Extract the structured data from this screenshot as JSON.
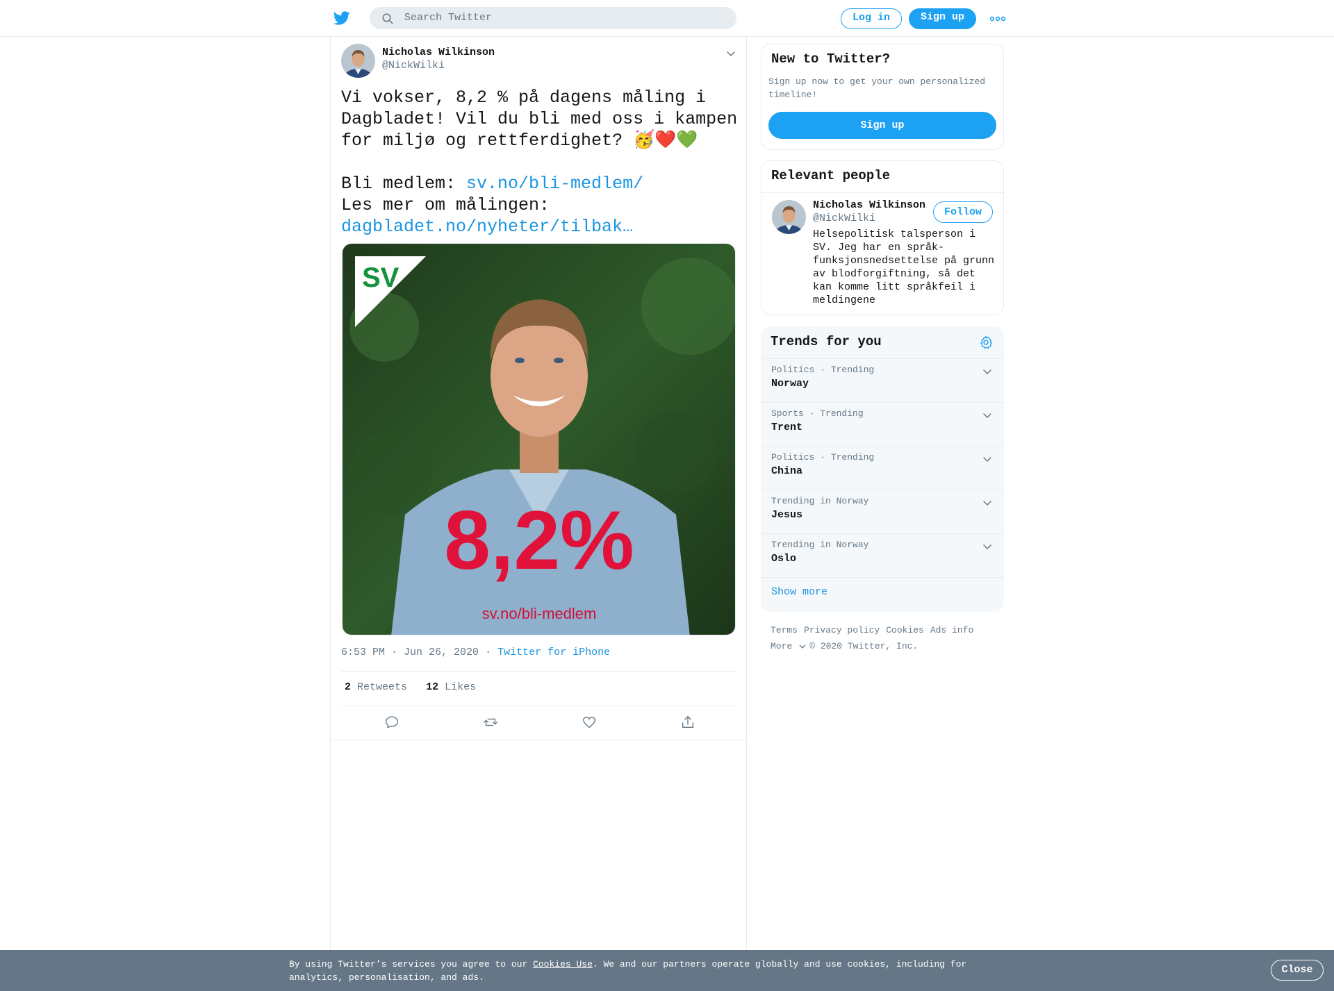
{
  "header": {
    "search_placeholder": "Search Twitter",
    "login_label": "Log in",
    "signup_label": "Sign up",
    "brand_color": "#1da1f2"
  },
  "tweet": {
    "author_name": "Nicholas Wilkinson",
    "author_handle": "@NickWilki",
    "text_line1": "Vi vokser, 8,2 % på dagens måling i Dagbladet! Vil du bli med oss i kampen for miljø og rettferdighet? 🥳❤️💚",
    "join_prefix": "Bli medlem: ",
    "join_link": "sv.no/bli-medlem/",
    "read_more_prefix": "Les mer om målingen:",
    "read_more_link": "dagbladet.no/nyheter/tilbak…",
    "image": {
      "logo_text": "SV",
      "percent": "8,2%",
      "url_text": "sv.no/bli-medlem"
    },
    "timestamp": "6:53 PM · Jun 26, 2020",
    "source_sep": "·",
    "source": "Twitter for iPhone",
    "retweets_count": "2",
    "retweets_label": "Retweets",
    "likes_count": "12",
    "likes_label": "Likes"
  },
  "sidebar": {
    "new_to_twitter": {
      "title": "New to Twitter?",
      "description": "Sign up now to get your own personalized timeline!",
      "button_label": "Sign up"
    },
    "relevant_people": {
      "title": "Relevant people",
      "name": "Nicholas Wilkinson",
      "handle": "@NickWilki",
      "follow_label": "Follow",
      "bio": "Helsepolitisk talsperson i SV. Jeg har en språk-funksjonsnedsettelse på grunn av blodforgiftning, så det kan komme litt språkfeil i meldingene"
    },
    "trends": {
      "title": "Trends for you",
      "items": [
        {
          "category": "Politics · Trending",
          "name": "Norway"
        },
        {
          "category": "Sports · Trending",
          "name": "Trent"
        },
        {
          "category": "Politics · Trending",
          "name": "China"
        },
        {
          "category": "Trending in Norway",
          "name": "Jesus"
        },
        {
          "category": "Trending in Norway",
          "name": "Oslo"
        }
      ],
      "show_more": "Show more"
    },
    "footer": {
      "terms": "Terms",
      "privacy": "Privacy policy",
      "cookies": "Cookies",
      "ads": "Ads info",
      "more": "More",
      "copyright": "© 2020 Twitter, Inc."
    }
  },
  "cookie_bar": {
    "text_before": "By using Twitter’s services you agree to our ",
    "link": "Cookies Use",
    "text_after": ". We and our partners operate globally and use cookies, including for analytics, personalisation, and ads.",
    "close_label": "Close"
  }
}
